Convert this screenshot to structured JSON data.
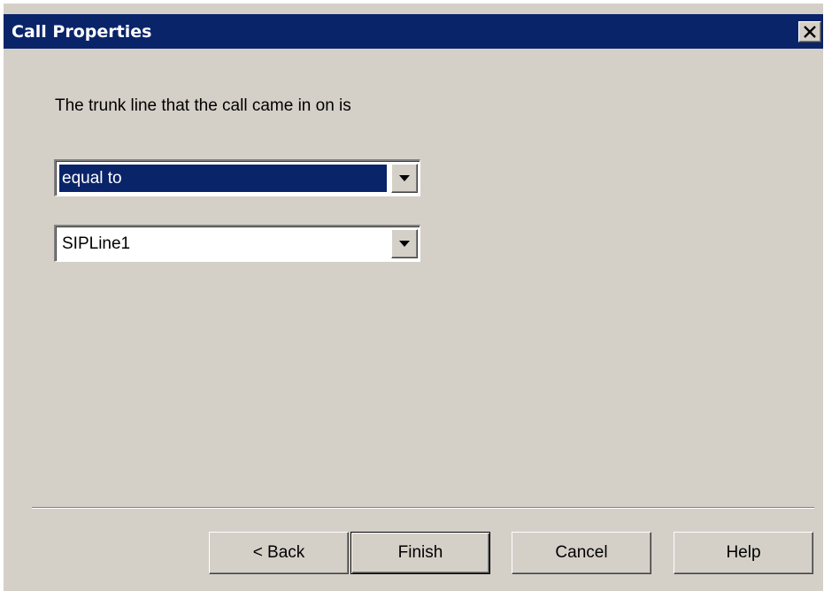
{
  "window": {
    "title": "Call Properties",
    "close_icon": "close-icon"
  },
  "content": {
    "prompt": "The trunk line that the call came in on is",
    "operator_combo": {
      "value": "equal to",
      "selected": true,
      "arrow_icon": "dropdown-arrow-icon"
    },
    "trunk_combo": {
      "value": "SIPLine1",
      "arrow_icon": "dropdown-arrow-icon"
    }
  },
  "buttons": {
    "back": "< Back",
    "finish": "Finish",
    "cancel": "Cancel",
    "help": "Help"
  },
  "colors": {
    "titlebar": "#0a246a",
    "face": "#d4d0c8",
    "selection": "#0a246a"
  }
}
